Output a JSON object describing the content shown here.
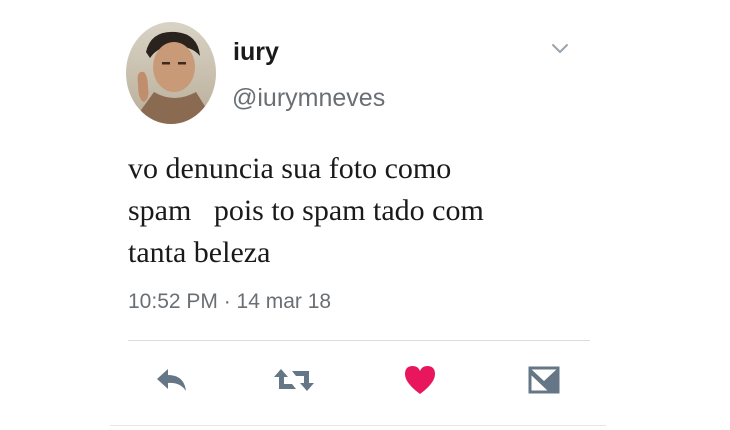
{
  "user": {
    "display_name": "iury",
    "handle": "@iurymneves"
  },
  "tweet": {
    "text": "vo denuncia sua foto como\nspam   pois to spam tado com\ntanta beleza",
    "timestamp": "10:52 PM · 14 mar 18"
  },
  "icons": {
    "menu": "chevron-down-icon",
    "reply": "reply-icon",
    "retweet": "retweet-icon",
    "like": "heart-icon",
    "share": "direct-message-icon"
  },
  "colors": {
    "like_active": "#e8175d",
    "icon_gray": "#657786",
    "text": "#1a1a1a",
    "secondary_text": "#6a6f74"
  }
}
